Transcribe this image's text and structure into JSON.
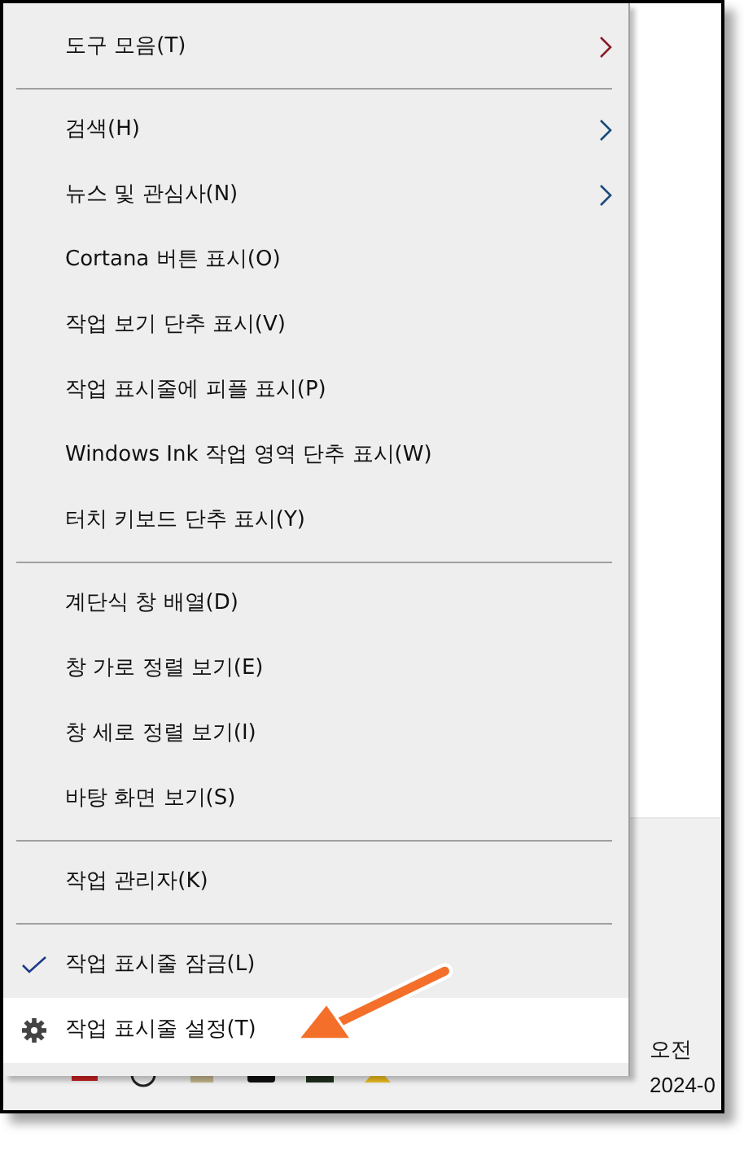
{
  "context_menu": {
    "items": [
      {
        "kind": "item",
        "label": "도구 모음(T)",
        "has_submenu": true,
        "checked": false,
        "selected": false
      },
      {
        "kind": "separator"
      },
      {
        "kind": "item",
        "label": "검색(H)",
        "has_submenu": true,
        "checked": false,
        "selected": false
      },
      {
        "kind": "item",
        "label": "뉴스 및 관심사(N)",
        "has_submenu": true,
        "checked": false,
        "selected": false
      },
      {
        "kind": "item",
        "label": "Cortana 버튼 표시(O)",
        "has_submenu": false,
        "checked": false,
        "selected": false
      },
      {
        "kind": "item",
        "label": "작업 보기 단추 표시(V)",
        "has_submenu": false,
        "checked": false,
        "selected": false
      },
      {
        "kind": "item",
        "label": "작업 표시줄에 피플 표시(P)",
        "has_submenu": false,
        "checked": false,
        "selected": false
      },
      {
        "kind": "item",
        "label": "Windows Ink 작업 영역 단추 표시(W)",
        "has_submenu": false,
        "checked": false,
        "selected": false
      },
      {
        "kind": "item",
        "label": "터치 키보드 단추 표시(Y)",
        "has_submenu": false,
        "checked": false,
        "selected": false
      },
      {
        "kind": "separator"
      },
      {
        "kind": "item",
        "label": "계단식 창 배열(D)",
        "has_submenu": false,
        "checked": false,
        "selected": false
      },
      {
        "kind": "item",
        "label": "창 가로 정렬 보기(E)",
        "has_submenu": false,
        "checked": false,
        "selected": false
      },
      {
        "kind": "item",
        "label": "창 세로 정렬 보기(I)",
        "has_submenu": false,
        "checked": false,
        "selected": false
      },
      {
        "kind": "item",
        "label": "바탕 화면 보기(S)",
        "has_submenu": false,
        "checked": false,
        "selected": false
      },
      {
        "kind": "separator"
      },
      {
        "kind": "item",
        "label": "작업 관리자(K)",
        "has_submenu": false,
        "checked": false,
        "selected": false
      },
      {
        "kind": "separator"
      },
      {
        "kind": "item",
        "label": "작업 표시줄 잠금(L)",
        "has_submenu": false,
        "checked": true,
        "selected": false
      },
      {
        "kind": "settings",
        "label": "작업 표시줄 설정(T)",
        "has_submenu": false,
        "checked": false,
        "selected": true
      }
    ]
  },
  "taskbar": {
    "clock_time": "오전",
    "clock_date": "2024-0"
  },
  "annotation": {
    "kind": "arrow"
  }
}
